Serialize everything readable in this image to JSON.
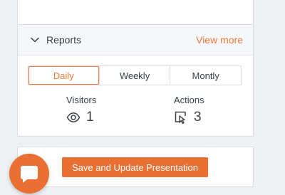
{
  "reports": {
    "title": "Reports",
    "view_more": "View more",
    "tabs": [
      {
        "label": "Daily",
        "active": true
      },
      {
        "label": "Weekly",
        "active": false
      },
      {
        "label": "Montly",
        "active": false
      }
    ],
    "stats": {
      "visitors": {
        "label": "Visitors",
        "value": "1",
        "icon": "eye-icon"
      },
      "actions": {
        "label": "Actions",
        "value": "3",
        "icon": "cursor-click-icon"
      }
    }
  },
  "save_button": {
    "label": "Save and Update Presentation"
  },
  "chat": {
    "icon": "chat-bubble-icon"
  },
  "colors": {
    "accent": "#e96f33",
    "accent_text": "#f07a3a",
    "text": "#3a4048",
    "border": "#d9dde3",
    "background": "#eef0f4"
  }
}
